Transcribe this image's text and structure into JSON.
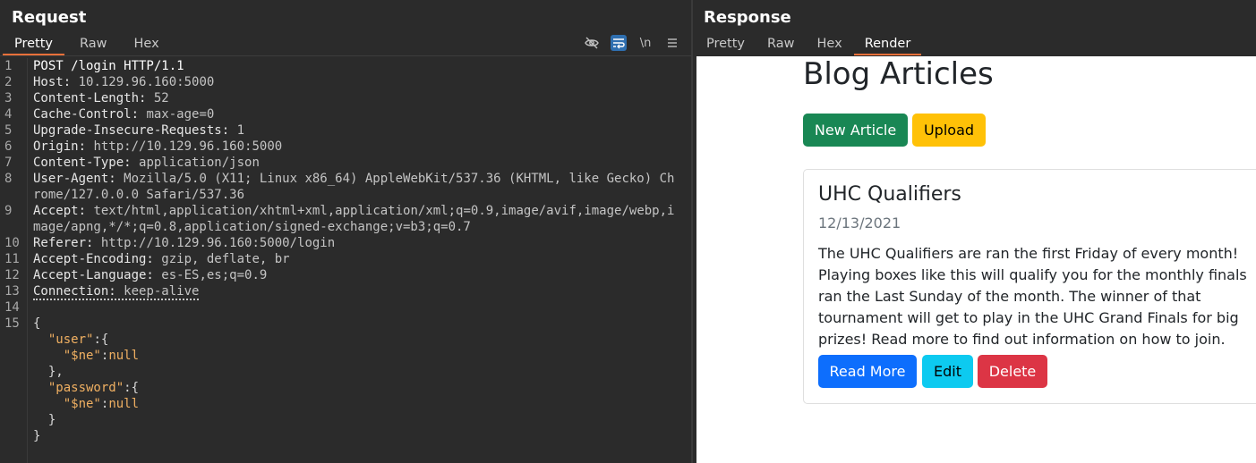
{
  "request": {
    "title": "Request",
    "tabs": [
      "Pretty",
      "Raw",
      "Hex"
    ],
    "active_tab": "Pretty",
    "toolbar_icons": [
      "eye-off-icon",
      "wrap-lines-icon",
      "newline-icon",
      "menu-icon"
    ],
    "newline_label": "\\n",
    "lines": {
      "l1": "POST /login HTTP/1.1",
      "l2": {
        "name": "Host:",
        "value": "10.129.96.160:5000"
      },
      "l3": {
        "name": "Content-Length:",
        "value": "52"
      },
      "l4": {
        "name": "Cache-Control:",
        "value": "max-age=0"
      },
      "l5": {
        "name": "Upgrade-Insecure-Requests:",
        "value": "1"
      },
      "l6": {
        "name": "Origin:",
        "value": "http://10.129.96.160:5000"
      },
      "l7": {
        "name": "Content-Type:",
        "value": "application/json"
      },
      "l8": {
        "name": "User-Agent:",
        "value": "Mozilla/5.0 (X11; Linux x86_64) AppleWebKit/537.36 (KHTML, like Gecko) Chrome/127.0.0.0 Safari/537.36"
      },
      "l9": {
        "name": "Accept:",
        "value": "text/html,application/xhtml+xml,application/xml;q=0.9,image/avif,image/webp,image/apng,*/*;q=0.8,application/signed-exchange;v=b3;q=0.7"
      },
      "l10": {
        "name": "Referer:",
        "value": "http://10.129.96.160:5000/login"
      },
      "l11": {
        "name": "Accept-Encoding:",
        "value": "gzip, deflate, br"
      },
      "l12": {
        "name": "Accept-Language:",
        "value": "es-ES,es;q=0.9"
      },
      "l13": {
        "name": "Connection:",
        "value": "keep-alive"
      },
      "l15": "{"
    },
    "line_numbers": [
      "1",
      "2",
      "3",
      "4",
      "5",
      "6",
      "7",
      "8",
      "9",
      "10",
      "11",
      "12",
      "13",
      "14",
      "15"
    ],
    "body": {
      "user_key": "\"user\"",
      "password_key": "\"password\"",
      "ne_key": "\"$ne\"",
      "null_val": "null",
      "open_obj": ":{",
      "colon": ":",
      "close_comma": "},",
      "close": "}",
      "close_root": "}"
    }
  },
  "response": {
    "title": "Response",
    "tabs": [
      "Pretty",
      "Raw",
      "Hex",
      "Render"
    ],
    "active_tab": "Render",
    "page": {
      "heading": "Blog Articles",
      "new_article_button": "New Article",
      "upload_button": "Upload",
      "card": {
        "title": "UHC Qualifiers",
        "date": "12/13/2021",
        "text": "The UHC Qualifiers are ran the first Friday of every month! Playing boxes like this will qualify you for the monthly finals ran the Last Sunday of the month. The winner of that tournament will get to play in the UHC Grand Finals for big prizes! Read more to find out information on how to join.",
        "read_more_button": "Read More",
        "edit_button": "Edit",
        "delete_button": "Delete"
      }
    }
  },
  "colors": {
    "accent_tab": "#e8703a",
    "new_article": "#198754",
    "upload": "#ffc107",
    "read_more": "#0d6efd",
    "edit": "#0dcaf0",
    "delete": "#dc3545",
    "json_string": "#f0b062"
  }
}
